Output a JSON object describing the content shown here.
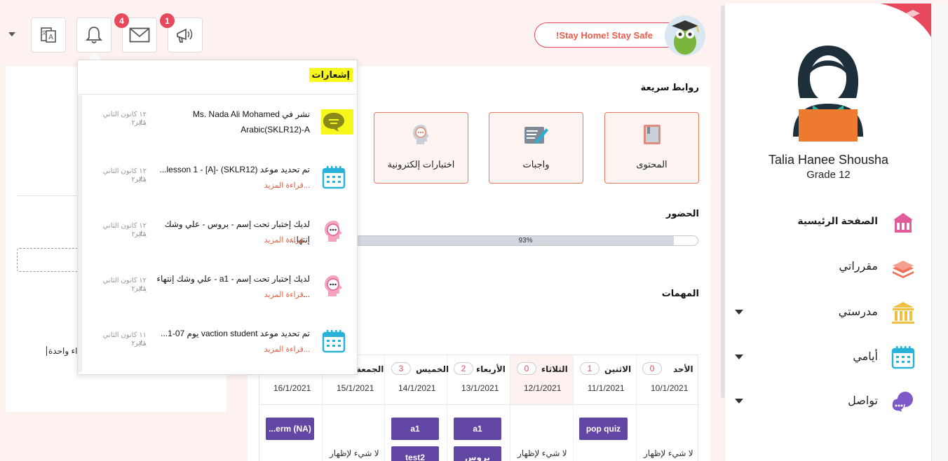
{
  "header": {
    "stay_safe": "!Stay Home! Stay Safe",
    "badges": {
      "messages": "4",
      "announcements": "1"
    }
  },
  "sidebar": {
    "student_name": "Talia Hanee Shousha",
    "grade": "Grade 12",
    "items": [
      {
        "label": "الصفحة الرئيسية",
        "icon": "school-building-icon",
        "color": "#e05b9a"
      },
      {
        "label": "مقرراتي",
        "icon": "books-stack-icon",
        "color": "#ee7258"
      },
      {
        "label": "مدرستي",
        "icon": "institution-columns-icon",
        "color": "#f1bf3e"
      },
      {
        "label": "أيامي",
        "icon": "calendar-icon",
        "color": "#2ab1d8"
      },
      {
        "label": "تواصل",
        "icon": "chat-bubbles-icon",
        "color": "#8059c8"
      }
    ]
  },
  "main": {
    "quick_links_title": "روابط سريعة",
    "quick_links": [
      {
        "label": "المحتوى",
        "icon": "book-icon"
      },
      {
        "label": "واجبات",
        "icon": "homework-pen-icon"
      },
      {
        "label": "اختبارات إلكترونية",
        "icon": "quiz-head-icon"
      }
    ],
    "attendance_title": "الحضور",
    "attendance_percent": "93%",
    "attendance_value": 0.93,
    "tasks_title": "المهمات",
    "days": [
      {
        "name": "الأحد",
        "count": "0",
        "date": "10/1/2021",
        "empty": "لا شيء لإظهار"
      },
      {
        "name": "الاثنين",
        "count": "1",
        "date": "11/1/2021"
      },
      {
        "name": "الثلاثاء",
        "count": "0",
        "date": "12/1/2021",
        "empty": "لا شيء لإظهار"
      },
      {
        "name": "الأربعاء",
        "count": "2",
        "date": "13/1/2021"
      },
      {
        "name": "الخميس",
        "count": "3",
        "date": "14/1/2021"
      },
      {
        "name": "الجمعة",
        "date": "15/1/2021",
        "empty": "لا شيء لإظهار"
      },
      {
        "date": "16/1/2021"
      }
    ],
    "tasks": {
      "mon": [
        "pop quiz"
      ],
      "wed": [
        "a1",
        "بروس"
      ],
      "thu": [
        "a1",
        "test2"
      ],
      "sat": [
        "...erm (NA)"
      ]
    }
  },
  "left_panel": {
    "fragment": "اء واحدة"
  },
  "notifications": {
    "title": "إشعارات",
    "read_more": "...قراءة المزيد",
    "items": [
      {
        "text1": "Ms. Nada Ali Mohamed نشر في",
        "text2": "Arabic(SKLR12)-A",
        "date1": "١٢ كانون الثاني يناير",
        "date2": "٢٠٢١",
        "icon": "chat-bubble-icon",
        "highlight": true
      },
      {
        "text1": "تم تحديد موعد lesson 1 - [A]- (SKLR12)...",
        "date1": "١٢ كانون الثاني يناير",
        "date2": "٢٠٢١",
        "icon": "calendar-icon"
      },
      {
        "text1": "لديك إختبار تحت إسم - بروس - علي وشك إنتها...",
        "date1": "١٢ كانون الثاني يناير",
        "date2": "٢٠٢١",
        "icon": "quiz-head-icon"
      },
      {
        "text1": "لديك إختبار تحت إسم - a1 - علي وشك إنتهاء ...",
        "date1": "١٢ كانون الثاني يناير",
        "date2": "٢٠٢١",
        "icon": "quiz-head-icon"
      },
      {
        "text1": "تم تحديد موعد vaction student يوم 07-1...",
        "date1": "١١ كانون الثاني يناير",
        "date2": "٢٠٢١",
        "icon": "calendar-icon"
      }
    ]
  }
}
